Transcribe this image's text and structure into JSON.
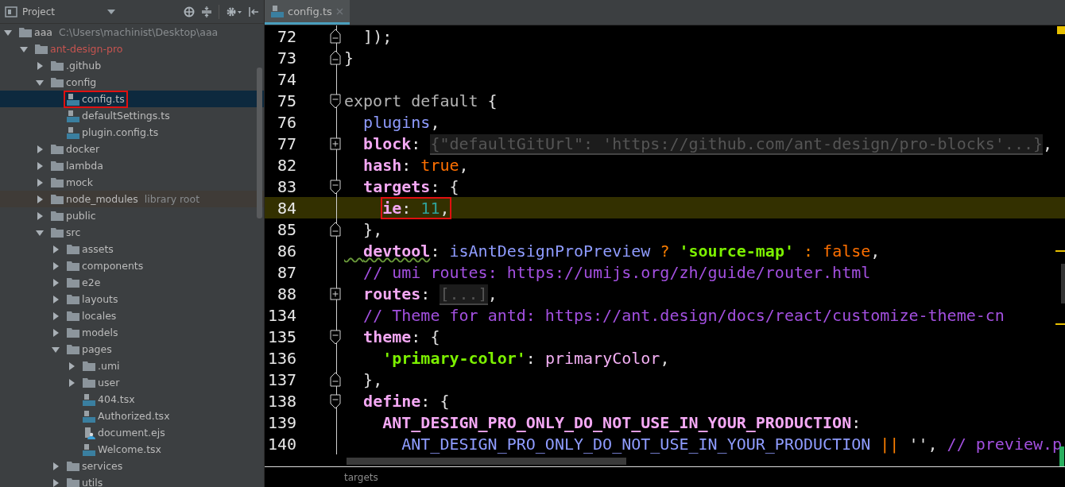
{
  "project_panel": {
    "title": "Project",
    "tree": [
      {
        "name": "aaa",
        "note": "C:\\Users\\machinist\\Desktop\\aaa",
        "kind": "folder",
        "expanded": true,
        "selected": false,
        "outlined": false,
        "children": [
          {
            "name": "ant-design-pro",
            "kind": "folder",
            "color": "#c75450",
            "expanded": true,
            "selected": false,
            "outlined": false,
            "children": [
              {
                "name": ".github",
                "kind": "folder",
                "expanded": false,
                "selected": false,
                "outlined": false
              },
              {
                "name": "config",
                "kind": "folder",
                "expanded": true,
                "selected": false,
                "outlined": false,
                "children": [
                  {
                    "name": "config.ts",
                    "kind": "ts",
                    "selected": true,
                    "outlined": true
                  },
                  {
                    "name": "defaultSettings.ts",
                    "kind": "ts",
                    "selected": false,
                    "outlined": false
                  },
                  {
                    "name": "plugin.config.ts",
                    "kind": "ts",
                    "selected": false,
                    "outlined": false
                  }
                ]
              },
              {
                "name": "docker",
                "kind": "folder",
                "expanded": false,
                "selected": false,
                "outlined": false
              },
              {
                "name": "lambda",
                "kind": "folder",
                "expanded": false,
                "selected": false,
                "outlined": false
              },
              {
                "name": "mock",
                "kind": "folder",
                "expanded": false,
                "selected": false,
                "outlined": false
              },
              {
                "name": "node_modules",
                "note": "library root",
                "kind": "library",
                "expanded": false,
                "selected": false,
                "outlined": false
              },
              {
                "name": "public",
                "kind": "folder",
                "expanded": false,
                "selected": false,
                "outlined": false
              },
              {
                "name": "src",
                "kind": "folder",
                "expanded": true,
                "selected": false,
                "outlined": false,
                "children": [
                  {
                    "name": "assets",
                    "kind": "folder",
                    "expanded": false,
                    "selected": false,
                    "outlined": false
                  },
                  {
                    "name": "components",
                    "kind": "folder",
                    "expanded": false,
                    "selected": false,
                    "outlined": false
                  },
                  {
                    "name": "e2e",
                    "kind": "folder",
                    "expanded": false,
                    "selected": false,
                    "outlined": false
                  },
                  {
                    "name": "layouts",
                    "kind": "folder",
                    "expanded": false,
                    "selected": false,
                    "outlined": false
                  },
                  {
                    "name": "locales",
                    "kind": "folder",
                    "expanded": false,
                    "selected": false,
                    "outlined": false
                  },
                  {
                    "name": "models",
                    "kind": "folder",
                    "expanded": false,
                    "selected": false,
                    "outlined": false
                  },
                  {
                    "name": "pages",
                    "kind": "folder",
                    "expanded": true,
                    "selected": false,
                    "outlined": false,
                    "children": [
                      {
                        "name": ".umi",
                        "kind": "folder",
                        "expanded": false,
                        "selected": false,
                        "outlined": false
                      },
                      {
                        "name": "user",
                        "kind": "folder",
                        "expanded": false,
                        "selected": false,
                        "outlined": false
                      },
                      {
                        "name": "404.tsx",
                        "kind": "tsx",
                        "selected": false,
                        "outlined": false
                      },
                      {
                        "name": "Authorized.tsx",
                        "kind": "tsx",
                        "selected": false,
                        "outlined": false
                      },
                      {
                        "name": "document.ejs",
                        "kind": "ejs",
                        "selected": false,
                        "outlined": false
                      },
                      {
                        "name": "Welcome.tsx",
                        "kind": "tsx",
                        "selected": false,
                        "outlined": false
                      }
                    ]
                  },
                  {
                    "name": "services",
                    "kind": "folder",
                    "expanded": false,
                    "selected": false,
                    "outlined": false
                  },
                  {
                    "name": "utils",
                    "kind": "folder",
                    "expanded": false,
                    "selected": false,
                    "outlined": false
                  }
                ]
              }
            ]
          }
        ]
      }
    ]
  },
  "editor": {
    "tabs": [
      {
        "label": "config.ts",
        "selected": true
      }
    ],
    "lines": [
      {
        "number": "72",
        "kind": "fold_end",
        "current": false,
        "boxed": false,
        "tokens": [
          {
            "kind": "punct",
            "text": "  ]);"
          }
        ]
      },
      {
        "number": "73",
        "kind": "fold_end",
        "current": false,
        "boxed": false,
        "tokens": [
          {
            "kind": "punct",
            "text": "}"
          }
        ]
      },
      {
        "number": "74",
        "kind": "plain",
        "current": false
      },
      {
        "number": "75",
        "kind": "fold_start",
        "current": false,
        "boxed": false,
        "tokens": [
          {
            "kind": "kw",
            "text": "export default"
          },
          {
            "kind": "punct",
            "text": " {"
          }
        ]
      },
      {
        "number": "76",
        "kind": "plain",
        "current": false,
        "boxed": false,
        "tokens": [
          {
            "kind": "ident",
            "text": "  plugins"
          },
          {
            "kind": "punct",
            "text": ","
          }
        ]
      },
      {
        "number": "77",
        "kind": "fold_collapsed",
        "current": false,
        "boxed": false,
        "tokens": [
          {
            "kind": "key",
            "text": "  block"
          },
          {
            "kind": "punct",
            "text": ": "
          },
          {
            "kind": "folded",
            "text": "{\"defaultGitUrl\": 'https://github.com/ant-design/pro-blocks'...}"
          },
          {
            "kind": "punct",
            "text": ","
          }
        ]
      },
      {
        "number": "82",
        "kind": "plain",
        "current": false,
        "boxed": false,
        "tokens": [
          {
            "kind": "key",
            "text": "  hash"
          },
          {
            "kind": "punct",
            "text": ": "
          },
          {
            "kind": "bool",
            "text": "true"
          },
          {
            "kind": "punct",
            "text": ","
          }
        ]
      },
      {
        "number": "83",
        "kind": "fold_start",
        "current": false,
        "boxed": false,
        "tokens": [
          {
            "kind": "key",
            "text": "  targets"
          },
          {
            "kind": "punct",
            "text": ": {"
          }
        ]
      },
      {
        "number": "84",
        "kind": "plain",
        "current": true,
        "boxed": true,
        "tokens": [
          {
            "kind": "key",
            "text": "    ie"
          },
          {
            "kind": "punct",
            "text": ": "
          },
          {
            "kind": "num",
            "text": "11"
          },
          {
            "kind": "punct",
            "text": ","
          }
        ]
      },
      {
        "number": "85",
        "kind": "fold_end",
        "current": false,
        "boxed": false,
        "tokens": [
          {
            "kind": "punct",
            "text": "  },"
          }
        ]
      },
      {
        "number": "86",
        "kind": "plain",
        "current": false,
        "boxed": false,
        "tokens": [
          {
            "kind": "key_warn",
            "text": "  devtool"
          },
          {
            "kind": "punct",
            "text": ": "
          },
          {
            "kind": "ident",
            "text": "isAntDesignProPreview"
          },
          {
            "kind": "op",
            "text": " ? "
          },
          {
            "kind": "str",
            "text": "'source-map'"
          },
          {
            "kind": "op",
            "text": " : "
          },
          {
            "kind": "bool",
            "text": "false"
          },
          {
            "kind": "punct",
            "text": ","
          }
        ]
      },
      {
        "number": "87",
        "kind": "plain",
        "current": false,
        "boxed": false,
        "tokens": [
          {
            "kind": "comment",
            "text": "  // umi routes: https://umijs.org/zh/guide/router.html"
          }
        ]
      },
      {
        "number": "88",
        "kind": "fold_collapsed",
        "current": false,
        "boxed": false,
        "tokens": [
          {
            "kind": "key",
            "text": "  routes"
          },
          {
            "kind": "punct",
            "text": ": "
          },
          {
            "kind": "folded",
            "text": "[...]"
          },
          {
            "kind": "punct",
            "text": ","
          }
        ]
      },
      {
        "number": "134",
        "kind": "plain",
        "current": false,
        "boxed": false,
        "tokens": [
          {
            "kind": "comment",
            "text": "  // Theme for antd: https://ant.design/docs/react/customize-theme-cn"
          }
        ]
      },
      {
        "number": "135",
        "kind": "fold_start",
        "current": false,
        "boxed": false,
        "tokens": [
          {
            "kind": "key",
            "text": "  theme"
          },
          {
            "kind": "punct",
            "text": ": {"
          }
        ]
      },
      {
        "number": "136",
        "kind": "plain",
        "current": false,
        "boxed": false,
        "tokens": [
          {
            "kind": "str",
            "text": "    'primary-color'"
          },
          {
            "kind": "punct",
            "text": ": "
          },
          {
            "kind": "ref",
            "text": "primaryColor"
          },
          {
            "kind": "punct",
            "text": ","
          }
        ]
      },
      {
        "number": "137",
        "kind": "fold_end",
        "current": false,
        "boxed": false,
        "tokens": [
          {
            "kind": "punct",
            "text": "  },"
          }
        ]
      },
      {
        "number": "138",
        "kind": "fold_start",
        "current": false,
        "boxed": false,
        "tokens": [
          {
            "kind": "key",
            "text": "  define"
          },
          {
            "kind": "punct",
            "text": ": {"
          }
        ]
      },
      {
        "number": "139",
        "kind": "plain",
        "current": false,
        "boxed": false,
        "tokens": [
          {
            "kind": "key",
            "text": "    ANT_DESIGN_PRO_ONLY_DO_NOT_USE_IN_YOUR_PRODUCTION"
          },
          {
            "kind": "punct",
            "text": ":"
          }
        ]
      },
      {
        "number": "140",
        "kind": "plain",
        "current": false,
        "boxed": false,
        "tokens": [
          {
            "kind": "ident",
            "text": "      ANT_DESIGN_PRO_ONLY_DO_NOT_USE_IN_YOUR_PRODUCTION"
          },
          {
            "kind": "op",
            "text": " || "
          },
          {
            "kind": "punct",
            "text": "'', "
          },
          {
            "kind": "comment",
            "text": "// preview.p"
          }
        ]
      }
    ],
    "breadcrumb": "targets"
  }
}
